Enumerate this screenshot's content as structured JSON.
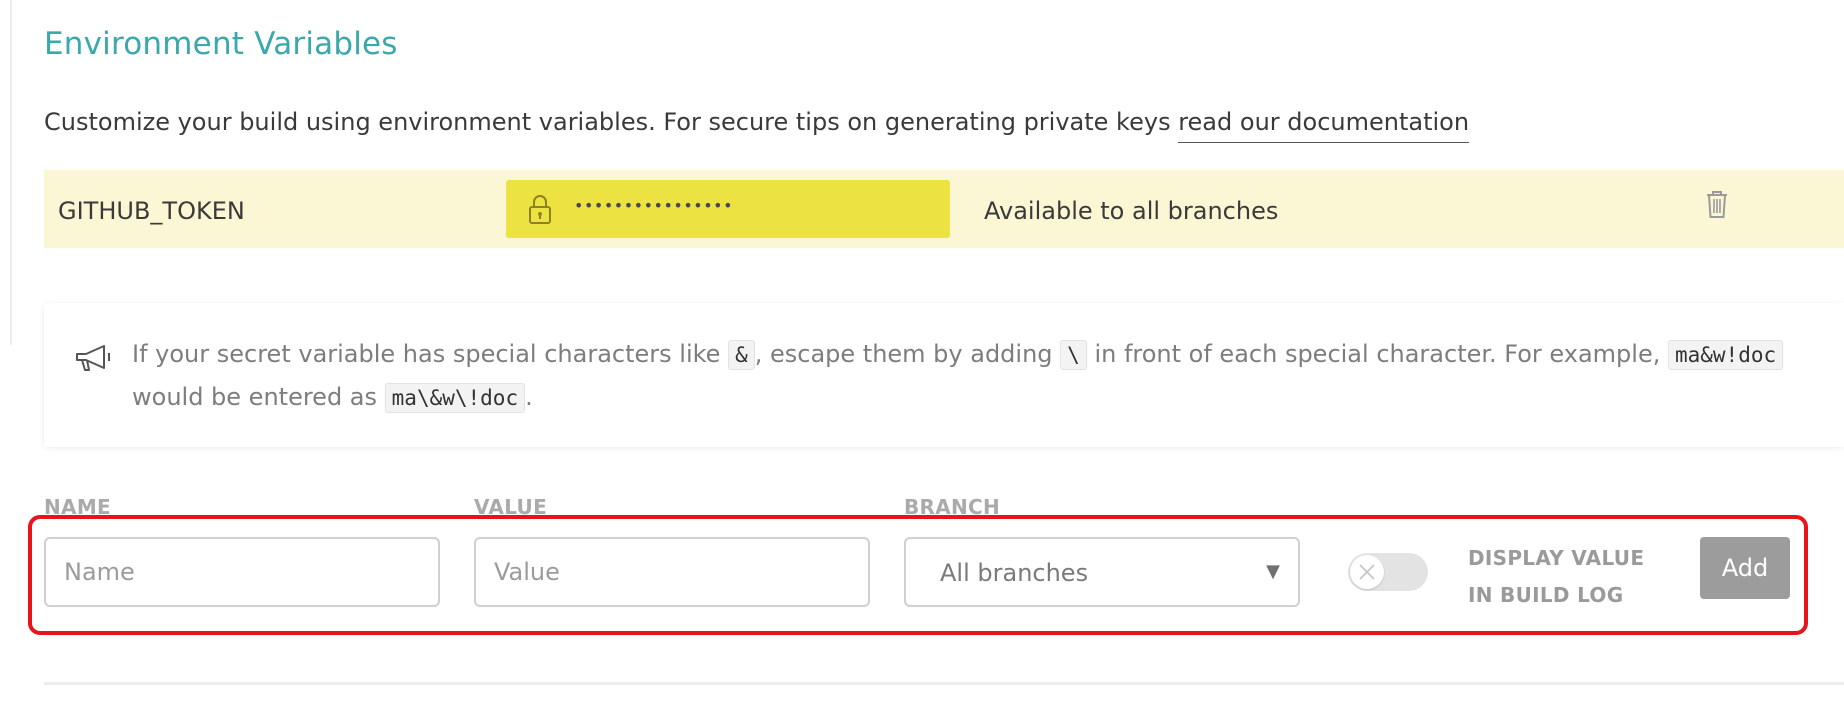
{
  "section": {
    "title": "Environment Variables",
    "intro_text": "Customize your build using environment variables. For secure tips on generating private keys ",
    "intro_link": "read our documentation"
  },
  "variable": {
    "name": "GITHUB_TOKEN",
    "masked_value": "••••••••••••••••",
    "branch": "Available to all branches"
  },
  "notice": {
    "part1": "If your secret variable has special characters like ",
    "code1": "&",
    "part2": ", escape them by adding ",
    "code2": "\\",
    "part3": " in front of each special character. For example, ",
    "code3": "ma&w!doc",
    "part4": " would be entered as ",
    "code4": "ma\\&w\\!doc",
    "part5": "."
  },
  "form": {
    "name_label": "NAME",
    "value_label": "VALUE",
    "branch_label": "BRANCH",
    "name_placeholder": "Name",
    "value_placeholder": "Value",
    "branch_selected": "All branches",
    "display_label_line1": "DISPLAY VALUE",
    "display_label_line2": "IN BUILD LOG",
    "add_label": "Add"
  },
  "colors": {
    "accent": "#3ba9ac",
    "row_background": "#fbf7d5",
    "masked_value_background": "#ece242",
    "highlight_border": "#e8141b",
    "add_button": "#9c9c9c"
  }
}
